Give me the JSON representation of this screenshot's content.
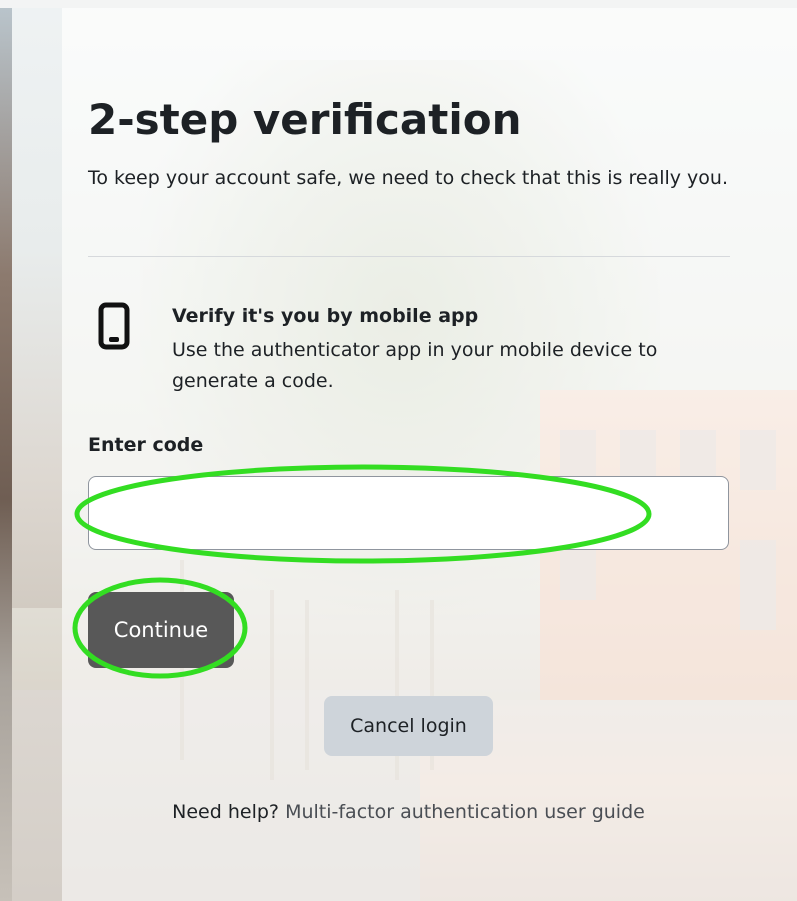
{
  "page": {
    "title": "2-step verification",
    "subtitle": "To keep your account safe, we need to check that this is really you."
  },
  "method": {
    "icon": "mobile-phone-icon",
    "title": "Verify it's you by mobile app",
    "description": "Use the authenticator app in your mobile device to generate a code."
  },
  "form": {
    "code_label": "Enter code",
    "code_value": "",
    "continue_label": "Continue",
    "cancel_label": "Cancel login"
  },
  "help": {
    "prefix": "Need help?",
    "link_text": "Multi-factor authentication user guide"
  },
  "colors": {
    "text": "#1d2125",
    "primary_button": "#585858",
    "secondary_button": "#ced4da",
    "annotation": "#33dd22"
  }
}
